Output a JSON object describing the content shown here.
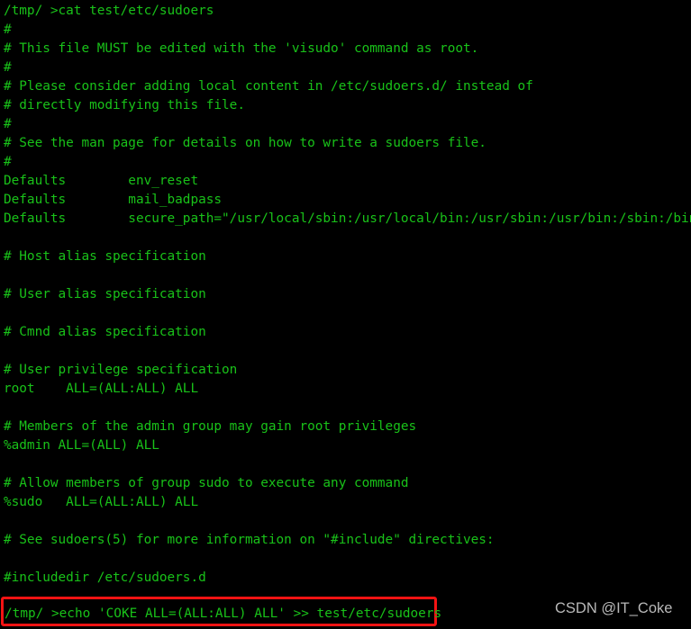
{
  "terminal": {
    "background_color": "#000000",
    "text_color": "#19c219",
    "highlight_color": "#f51313",
    "prompt": "/tmp/ >",
    "command_run": "cat test/etc/sudoers",
    "lines": [
      "/tmp/ >cat test/etc/sudoers",
      "#",
      "# This file MUST be edited with the 'visudo' command as root.",
      "#",
      "# Please consider adding local content in /etc/sudoers.d/ instead of",
      "# directly modifying this file.",
      "#",
      "# See the man page for details on how to write a sudoers file.",
      "#",
      "Defaults        env_reset",
      "Defaults        mail_badpass",
      "Defaults        secure_path=\"/usr/local/sbin:/usr/local/bin:/usr/sbin:/usr/bin:/sbin:/bin:/snap/bin\"",
      "",
      "# Host alias specification",
      "",
      "# User alias specification",
      "",
      "# Cmnd alias specification",
      "",
      "# User privilege specification",
      "root    ALL=(ALL:ALL) ALL",
      "",
      "# Members of the admin group may gain root privileges",
      "%admin ALL=(ALL) ALL",
      "",
      "# Allow members of group sudo to execute any command",
      "%sudo   ALL=(ALL:ALL) ALL",
      "",
      "# See sudoers(5) for more information on \"#include\" directives:",
      "",
      "#includedir /etc/sudoers.d"
    ]
  },
  "command_entry": {
    "text": "/tmp/ >echo 'COKE ALL=(ALL:ALL) ALL' >> test/etc/sudoers",
    "prompt": "/tmp/ >",
    "command": "echo 'COKE ALL=(ALL:ALL) ALL' >> test/etc/sudoers",
    "border_color": "#f51313"
  },
  "watermark": {
    "text": "CSDN @IT_Coke",
    "color": "#b9b9b9"
  }
}
